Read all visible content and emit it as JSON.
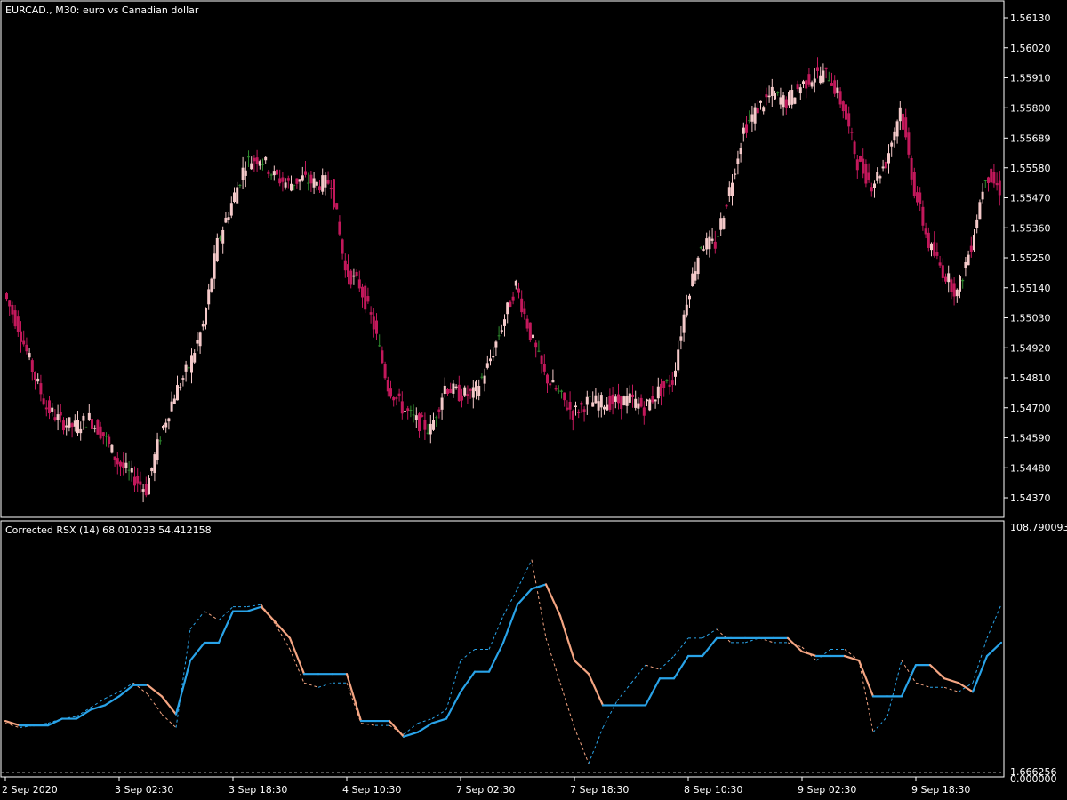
{
  "header": {
    "main_title": "EURCAD., M30:  euro vs Canadian dollar",
    "indicator_title": "Corrected RSX (14) 68.010233 54.412158"
  },
  "colors": {
    "background": "#000000",
    "frame": "#ffffff",
    "bull_candle": "#f4c9c9",
    "bear_candle": "#c2185b",
    "doji_candle": "#2e8b2e",
    "rsx_up": "#29a3e8",
    "rsx_down": "#f4a582",
    "rsx_dashed": "#29a3e8",
    "rsx_dashed_down": "#f4a582",
    "level_line": "#aaaaaa"
  },
  "price_axis": {
    "ticks": [
      "1.56130",
      "1.56020",
      "1.55910",
      "1.55800",
      "1.55689",
      "1.55580",
      "1.55470",
      "1.55360",
      "1.55250",
      "1.55140",
      "1.55030",
      "1.54920",
      "1.54810",
      "1.54700",
      "1.54590",
      "1.54480",
      "1.54370"
    ]
  },
  "indicator_axis": {
    "top_label": "108.790093",
    "bottom_label_a": "1.666256",
    "bottom_label_b": "0.000000"
  },
  "time_axis": {
    "labels": [
      "2 Sep 2020",
      "3 Sep 02:30",
      "3 Sep 18:30",
      "4 Sep 10:30",
      "7 Sep 02:30",
      "7 Sep 18:30",
      "8 Sep 10:30",
      "9 Sep 02:30",
      "9 Sep 18:30"
    ]
  },
  "chart_data": [
    {
      "type": "line",
      "title": "EURCAD., M30:  euro vs Canadian dollar",
      "ylim": [
        1.543,
        1.562
      ],
      "yticks": [
        1.5613,
        1.5602,
        1.5591,
        1.558,
        1.55689,
        1.5558,
        1.5547,
        1.5536,
        1.5525,
        1.5514,
        1.5503,
        1.5492,
        1.5481,
        1.547,
        1.5459,
        1.5448,
        1.5437
      ],
      "x": [
        0,
        16,
        32,
        48,
        64,
        80,
        96,
        112,
        128,
        144,
        160,
        176,
        192,
        208,
        224,
        240,
        256,
        272,
        288,
        304,
        320,
        336,
        352,
        368,
        384,
        400,
        416,
        432,
        448,
        464,
        480,
        496,
        512,
        528,
        544,
        560,
        576,
        592,
        608,
        624,
        640,
        656,
        672,
        688,
        704,
        720,
        736,
        752,
        768,
        784,
        800,
        816,
        832,
        848,
        864,
        880,
        896,
        912,
        928,
        944,
        960,
        976,
        992,
        1008,
        1024,
        1040,
        1056,
        1072,
        1088,
        1104,
        1120
      ],
      "x_tick_labels": [
        "2 Sep 2020",
        "3 Sep 02:30",
        "3 Sep 18:30",
        "4 Sep 10:30",
        "7 Sep 02:30",
        "7 Sep 18:30",
        "8 Sep 10:30",
        "9 Sep 02:30",
        "9 Sep 18:30"
      ],
      "x_tick_at": [
        0,
        128,
        256,
        384,
        512,
        640,
        768,
        896,
        1024
      ],
      "close": [
        1.5512,
        1.55,
        1.5484,
        1.547,
        1.5465,
        1.5463,
        1.5466,
        1.546,
        1.545,
        1.5445,
        1.544,
        1.546,
        1.5475,
        1.5485,
        1.55,
        1.553,
        1.5545,
        1.556,
        1.5562,
        1.5555,
        1.5552,
        1.5554,
        1.5552,
        1.5553,
        1.552,
        1.5515,
        1.55,
        1.5478,
        1.547,
        1.5465,
        1.5462,
        1.5478,
        1.5475,
        1.5475,
        1.5485,
        1.55,
        1.5515,
        1.5497,
        1.5482,
        1.5475,
        1.5468,
        1.5472,
        1.5472,
        1.5472,
        1.5473,
        1.547,
        1.5476,
        1.548,
        1.551,
        1.553,
        1.553,
        1.555,
        1.5572,
        1.558,
        1.5585,
        1.5582,
        1.5588,
        1.5592,
        1.5592,
        1.558,
        1.556,
        1.5552,
        1.556,
        1.558,
        1.555,
        1.553,
        1.552,
        1.5512,
        1.553,
        1.5556,
        1.555
      ]
    },
    {
      "type": "line",
      "title": "Corrected RSX (14) 68.010233 54.412158",
      "ylim": [
        0,
        108.790093
      ],
      "series": [
        {
          "name": "",
          "x": [
            0,
            16,
            32,
            48,
            64,
            80,
            96,
            112,
            128,
            144,
            160,
            176,
            192,
            208,
            224,
            240,
            256,
            272,
            288,
            304,
            320,
            336,
            352,
            368,
            384,
            400,
            416,
            432,
            448,
            464,
            480,
            496,
            512,
            528,
            544,
            560,
            576,
            592,
            608,
            624,
            640,
            656,
            672,
            688,
            704,
            720,
            736,
            752,
            768,
            784,
            800,
            816,
            832,
            848,
            864,
            880,
            896,
            912,
            928,
            944,
            960,
            976,
            992,
            1008,
            1024,
            1040,
            1056,
            1072,
            1088,
            1104,
            1120
          ],
          "values": [
            23,
            21,
            21,
            21,
            24,
            24,
            28,
            30,
            34,
            39,
            39,
            34,
            26,
            50,
            58,
            58,
            72,
            72,
            74,
            67,
            60,
            44,
            44,
            44,
            44,
            23,
            23,
            23,
            16,
            18,
            22,
            24,
            36,
            45,
            45,
            58,
            75,
            82,
            84,
            70,
            50,
            44,
            30,
            30,
            30,
            30,
            42,
            42,
            52,
            52,
            60,
            60,
            60,
            60,
            60,
            60,
            54,
            52,
            52,
            52,
            50,
            34,
            34,
            34,
            48,
            48,
            42,
            40,
            36,
            52,
            58
          ]
        },
        {
          "name": "",
          "x": [
            0,
            16,
            32,
            48,
            64,
            80,
            96,
            112,
            128,
            144,
            160,
            176,
            192,
            208,
            224,
            240,
            256,
            272,
            288,
            304,
            320,
            336,
            352,
            368,
            384,
            400,
            416,
            432,
            448,
            464,
            480,
            496,
            512,
            528,
            544,
            560,
            576,
            592,
            608,
            624,
            640,
            656,
            672,
            688,
            704,
            720,
            736,
            752,
            768,
            784,
            800,
            816,
            832,
            848,
            864,
            880,
            896,
            912,
            928,
            944,
            960,
            976,
            992,
            1008,
            1024,
            1040,
            1056,
            1072,
            1088,
            1104,
            1120
          ],
          "values": [
            22,
            20,
            21,
            22,
            24,
            25,
            29,
            33,
            36,
            40,
            35,
            26,
            20,
            64,
            72,
            68,
            74,
            74,
            75,
            66,
            55,
            40,
            38,
            40,
            40,
            22,
            21,
            21,
            17,
            22,
            24,
            28,
            50,
            55,
            55,
            70,
            82,
            95,
            60,
            40,
            20,
            4,
            20,
            32,
            40,
            48,
            46,
            52,
            60,
            60,
            64,
            58,
            58,
            60,
            58,
            58,
            56,
            50,
            55,
            55,
            50,
            18,
            25,
            50,
            40,
            38,
            38,
            36,
            40,
            60,
            75
          ]
        }
      ]
    }
  ]
}
